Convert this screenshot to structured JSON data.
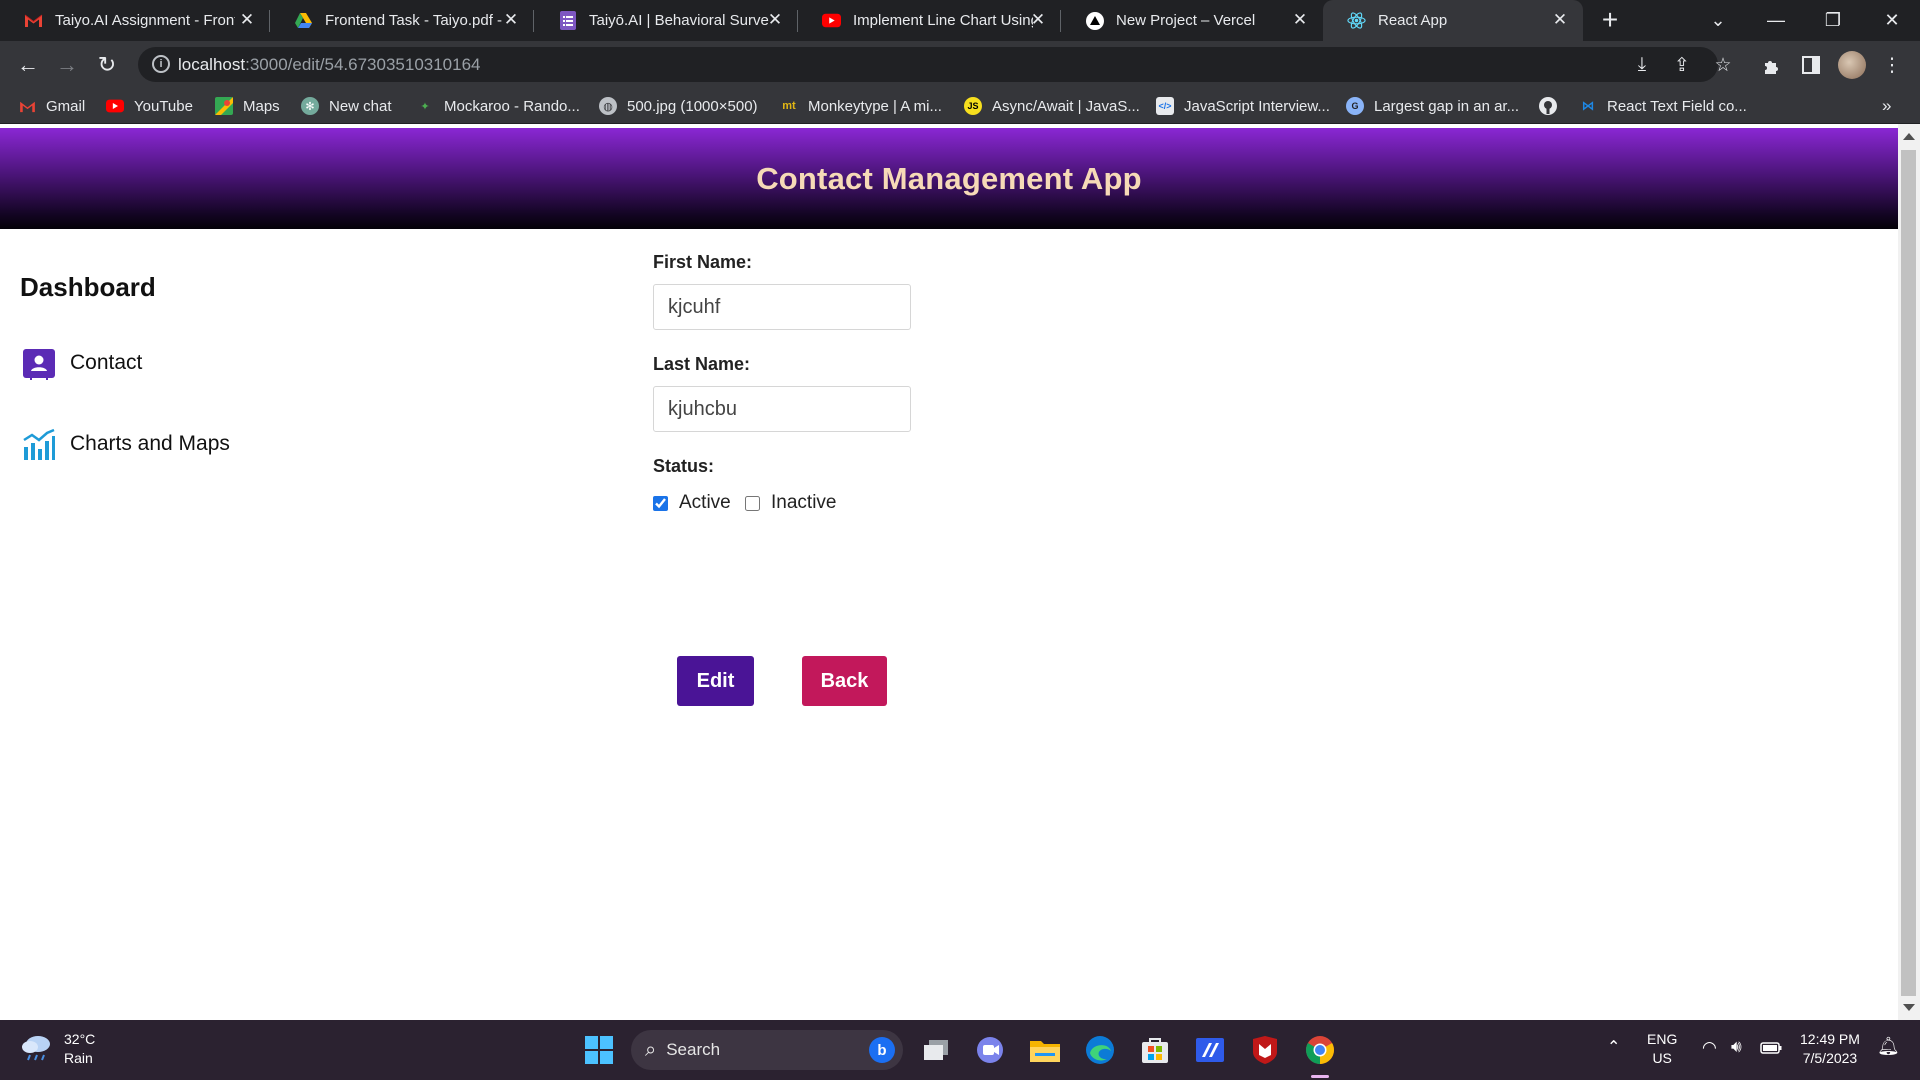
{
  "browser": {
    "tabs": [
      {
        "title": "Taiyo.AI Assignment - Front",
        "icon": "gmail-icon",
        "active": false
      },
      {
        "title": "Frontend Task - Taiyo.pdf - G",
        "icon": "google-drive-icon",
        "active": false
      },
      {
        "title": "Taiyō.AI | Behavioral Survey",
        "icon": "google-forms-icon",
        "active": false
      },
      {
        "title": "Implement Line Chart Using",
        "icon": "youtube-icon",
        "active": false
      },
      {
        "title": "New Project – Vercel",
        "icon": "vercel-icon",
        "active": false
      },
      {
        "title": "React App",
        "icon": "react-icon",
        "active": true
      }
    ],
    "url_host": "localhost",
    "url_path": ":3000/edit/54.67303510310164",
    "bookmarks": [
      {
        "label": "Gmail",
        "icon": "gmail-icon"
      },
      {
        "label": "YouTube",
        "icon": "youtube-icon"
      },
      {
        "label": "Maps",
        "icon": "maps-icon"
      },
      {
        "label": "New chat",
        "icon": "chatgpt-icon"
      },
      {
        "label": "Mockaroo - Rando...",
        "icon": "mockaroo-icon"
      },
      {
        "label": "500.jpg (1000×500)",
        "icon": "globe-icon"
      },
      {
        "label": "Monkeytype | A mi...",
        "icon": "monkeytype-icon"
      },
      {
        "label": "Async/Await | JavaS...",
        "icon": "js-icon"
      },
      {
        "label": "JavaScript Interview...",
        "icon": "js-interview-icon"
      },
      {
        "label": "Largest gap in an ar...",
        "icon": "gfg-icon"
      },
      {
        "label": "",
        "icon": "github-icon"
      },
      {
        "label": "React Text Field co...",
        "icon": "mui-icon"
      }
    ]
  },
  "app": {
    "title": "Contact Management App",
    "sidebar": {
      "heading": "Dashboard",
      "items": [
        {
          "label": "Contact",
          "icon": "contact-icon"
        },
        {
          "label": "Charts and Maps",
          "icon": "chart-icon"
        }
      ]
    },
    "form": {
      "first_name_label": "First Name:",
      "first_name_value": "kjcuhf",
      "last_name_label": "Last Name:",
      "last_name_value": "kjuhcbu",
      "status_label": "Status:",
      "status_options": [
        {
          "label": "Active",
          "checked": true
        },
        {
          "label": "Inactive",
          "checked": false
        }
      ],
      "edit_label": "Edit",
      "back_label": "Back"
    },
    "colors": {
      "header_gradient_top": "#8a27d4",
      "header_text": "#f6dab7",
      "edit_button": "#4a1496",
      "back_button": "#c2185b",
      "sidebar_icon_contact": "#5b2bb5",
      "sidebar_icon_chart": "#1e9bd7"
    }
  },
  "taskbar": {
    "temperature": "32°C",
    "weather": "Rain",
    "search_placeholder": "Search",
    "language_line1": "ENG",
    "language_line2": "US",
    "time": "12:49 PM",
    "date": "7/5/2023"
  }
}
